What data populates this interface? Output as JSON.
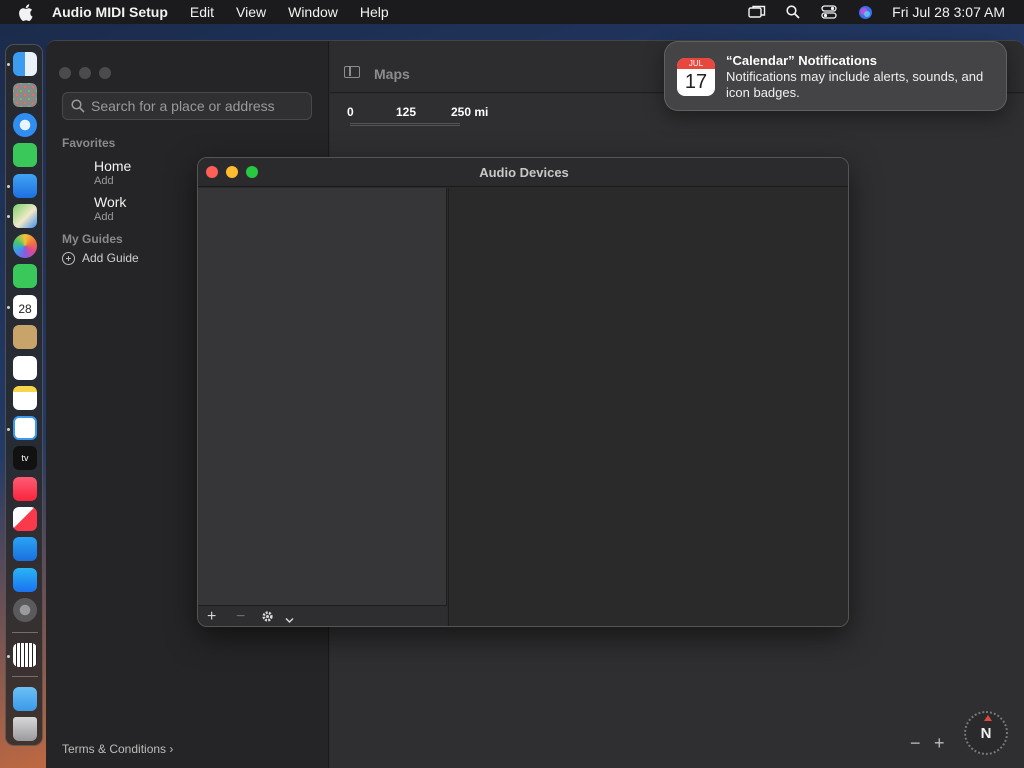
{
  "menubar": {
    "app_name": "Audio MIDI Setup",
    "items": [
      "Edit",
      "View",
      "Window",
      "Help"
    ],
    "clock": "Fri Jul 28  3:07 AM"
  },
  "maps": {
    "title": "Maps",
    "search_placeholder": "Search for a place or address",
    "favorites_title": "Favorites",
    "favorites": [
      {
        "name": "Home",
        "sub": "Add"
      },
      {
        "name": "Work",
        "sub": "Add"
      }
    ],
    "guides_title": "My Guides",
    "add_guide": "Add Guide",
    "terms": "Terms & Conditions",
    "scale": [
      "0",
      "125",
      "250 mi"
    ],
    "compass": "N",
    "zoom_out": "−",
    "zoom_in": "+"
  },
  "audio_window": {
    "title": "Audio Devices",
    "add_label": "+",
    "remove_label": "−"
  },
  "notification": {
    "cal_month": "JUL",
    "cal_day": "17",
    "title": "“Calendar” Notifications",
    "body": "Notifications may include alerts, sounds, and icon badges."
  },
  "colors": {
    "close": "#ff5f57",
    "minimize": "#febc2e",
    "zoom": "#28c840",
    "calendar_red": "#e8473d"
  }
}
